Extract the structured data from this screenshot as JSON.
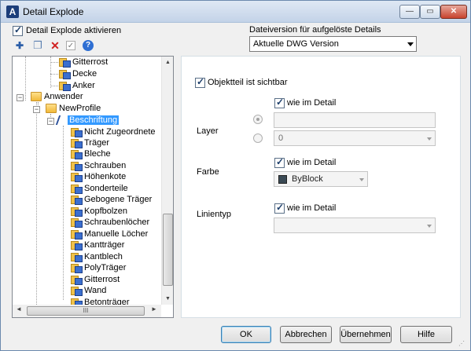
{
  "window": {
    "title": "Detail Explode",
    "icon_letter": "A",
    "min_glyph": "—",
    "max_glyph": "▭",
    "close_glyph": "✕"
  },
  "top": {
    "enable_label": "Detail Explode aktivieren",
    "enable_checked": true,
    "version_label": "Dateiversion für aufgelöste Details",
    "version_selected": "Aktuelle DWG Version"
  },
  "toolbar": {
    "icons": [
      "new-item-icon",
      "copy-icon",
      "delete-icon",
      "check-icon",
      "help-icon"
    ],
    "new_glyph": "✚",
    "copy_glyph": "❐",
    "delete_glyph": "✕",
    "check_glyph": "✓",
    "help_glyph": "?"
  },
  "tree": {
    "items": [
      {
        "label": "Gitterrost",
        "type": "item"
      },
      {
        "label": "Decke",
        "type": "item"
      },
      {
        "label": "Anker",
        "type": "item"
      },
      {
        "label": "Anwender",
        "type": "folder",
        "expander": "−"
      },
      {
        "label": "NewProfile",
        "type": "folder",
        "expander": "−"
      },
      {
        "label": "Beschriftung",
        "type": "profile",
        "expander": "−",
        "selected": true
      },
      {
        "label": "Nicht Zugeordnete",
        "type": "item"
      },
      {
        "label": "Träger",
        "type": "item"
      },
      {
        "label": "Bleche",
        "type": "item"
      },
      {
        "label": "Schrauben",
        "type": "item"
      },
      {
        "label": "Höhenkote",
        "type": "item"
      },
      {
        "label": "Sonderteile",
        "type": "item"
      },
      {
        "label": "Gebogene Träger",
        "type": "item"
      },
      {
        "label": "Kopfbolzen",
        "type": "item"
      },
      {
        "label": "Schraubenlöcher",
        "type": "item"
      },
      {
        "label": "Manuelle Löcher",
        "type": "item"
      },
      {
        "label": "Kantträger",
        "type": "item"
      },
      {
        "label": "Kantblech",
        "type": "item"
      },
      {
        "label": "PolyTräger",
        "type": "item"
      },
      {
        "label": "Gitterrost",
        "type": "item"
      },
      {
        "label": "Wand",
        "type": "item"
      },
      {
        "label": "Betonträger",
        "type": "item"
      }
    ],
    "hscroll_grip": "III",
    "up_glyph": "▲",
    "down_glyph": "▼",
    "left_glyph": "◄",
    "right_glyph": "►"
  },
  "properties": {
    "visible_label": "Objektteil ist sichtbar",
    "visible_checked": true,
    "layer_label": "Layer",
    "layer_same_label": "wie im Detail",
    "layer_text_value": "",
    "layer_select_value": "0",
    "color_label": "Farbe",
    "color_same_label": "wie im Detail",
    "color_value": "ByBlock",
    "color_swatch": "#3b4a55",
    "linetype_label": "Linientyp",
    "linetype_same_label": "wie im Detail",
    "linetype_value": ""
  },
  "buttons": {
    "ok": "OK",
    "cancel": "Abbrechen",
    "apply": "Übernehmen",
    "help": "Hilfe"
  },
  "resize_grip": "⋰"
}
